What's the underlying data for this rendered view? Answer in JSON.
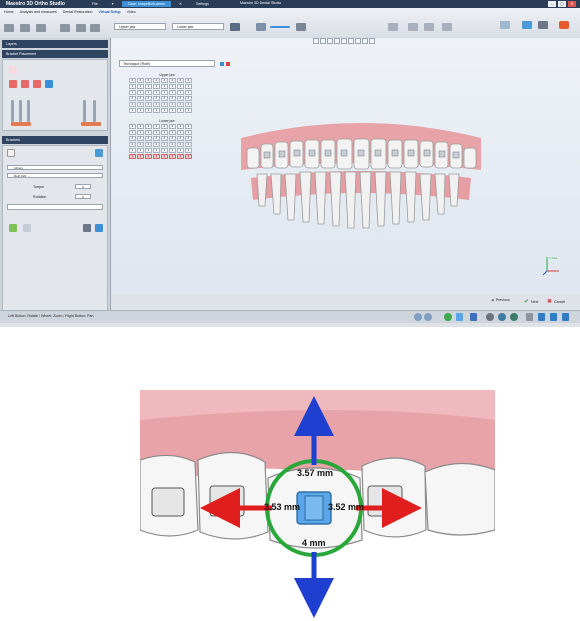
{
  "app": {
    "title": "Maestro 3D Ortho Studio",
    "window_title": "Maestro 3D Dental Studio",
    "menu_tabs": [
      "File",
      "Case: shapeBuilt-demo",
      "Settings"
    ],
    "window_buttons": [
      "–",
      "▢",
      "✕"
    ]
  },
  "ribbon": {
    "tabs": [
      "Home",
      "Analysis and measures",
      "Dental Restoration",
      "Virtual Setup",
      "Video"
    ],
    "active_tab": "Virtual Setup",
    "upper_jaw_select": "Upper jaw",
    "lower_jaw_select": "Lower jaw"
  },
  "left_panel": {
    "layers_header": "Layers",
    "bracket_placement_header": "Bracket Placement",
    "brackets_header": "Brackets",
    "rows": [
      {
        "label": "Library",
        "value": ""
      },
      {
        "label": "Roth 022",
        "value": ""
      }
    ],
    "torque_label": "Torque",
    "torque_value": "0",
    "rotation_label": "Rotation",
    "rotation_value": "0"
  },
  "viewport": {
    "technique_label": "Technique (Roth)",
    "upper_jaw_label": "Upper jaw",
    "lower_jaw_label": "Lower jaw",
    "upper_values": [
      [
        "0",
        "0",
        "0",
        "0",
        "0",
        "0",
        "0",
        "0"
      ],
      [
        "0",
        "0",
        "0",
        "0",
        "0",
        "0",
        "0",
        "0"
      ],
      [
        "0",
        "0",
        "0",
        "0",
        "0",
        "0",
        "0",
        "0"
      ],
      [
        "0",
        "0",
        "0",
        "0",
        "0",
        "0",
        "0",
        "0"
      ],
      [
        "0",
        "0",
        "0",
        "0",
        "0",
        "0",
        "0",
        "0"
      ],
      [
        "0",
        "0",
        "0",
        "0",
        "0",
        "0",
        "0",
        "0"
      ]
    ],
    "lower_values": [
      [
        "0",
        "0",
        "0",
        "0",
        "0",
        "0",
        "0",
        "0"
      ],
      [
        "0",
        "0",
        "0",
        "0",
        "0",
        "0",
        "0",
        "0"
      ],
      [
        "0",
        "0",
        "0",
        "0",
        "0",
        "0",
        "0",
        "0"
      ],
      [
        "0",
        "0",
        "0",
        "0",
        "0",
        "0",
        "0",
        "0"
      ],
      [
        "0",
        "0",
        "0",
        "0",
        "0",
        "0",
        "0",
        "0"
      ],
      [
        "0",
        "0",
        "0",
        "0",
        "0",
        "0",
        "0",
        "0"
      ]
    ],
    "axis_labels": {
      "y": "Y Axis",
      "x": "X",
      "z": "Z"
    }
  },
  "nav": {
    "previous": "Previous",
    "next": "Next",
    "cancel": "Cancel"
  },
  "status": {
    "hint": "Left Button: Rotate / Wheel: Zoom / Right Button: Pan"
  },
  "zoom_view": {
    "top_measure": "3.57 mm",
    "left_measure": "3.53 mm",
    "right_measure": "3.52 mm",
    "bottom_measure": "4 mm"
  },
  "colors": {
    "titlebar": "#2a3d57",
    "accent": "#3b8fd6",
    "gum": "#e8a3a8",
    "bracket_selected": "#5aa6e8",
    "ring": "#29a83a",
    "arrow_vertical": "#1f3fd1",
    "arrow_horizontal": "#e01e1e"
  }
}
